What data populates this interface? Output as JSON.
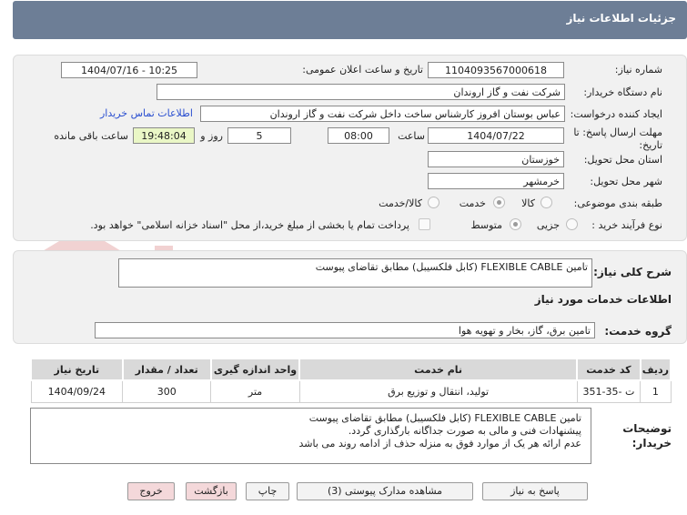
{
  "header": {
    "title": "جزئیات اطلاعات نیاز"
  },
  "fields": {
    "need_number_label": "شماره نیاز:",
    "need_number": "1104093567000618",
    "announce_label": "تاریخ و ساعت اعلان عمومی:",
    "announce_value": "1404/07/16 - 10:25",
    "buyer_label": "نام دستگاه خریدار:",
    "buyer_value": "شرکت نفت و گاز اروندان",
    "creator_label": "ایجاد کننده درخواست:",
    "creator_value": "عباس بوستان افروز کارشناس ساخت داخل شرکت نفت و گاز اروندان",
    "contact_link": "اطلاعات تماس خریدار",
    "deadline_label_1": "مهلت ارسال پاسخ: تا",
    "deadline_label_2": "تاریخ:",
    "deadline_date": "1404/07/22",
    "time_label": "ساعت",
    "deadline_time": "08:00",
    "days_value": "5",
    "days_label": "روز و",
    "remaining_time": "19:48:04",
    "remaining_label": "ساعت باقی مانده",
    "province_label": "استان محل تحویل:",
    "province_value": "خوزستان",
    "city_label": "شهر محل تحویل:",
    "city_value": "خرمشهر",
    "category_label": "طبقه بندی موضوعی:",
    "category_options": [
      "کالا",
      "خدمت",
      "کالا/خدمت"
    ],
    "process_label": "نوع فرآیند خرید :",
    "process_options": [
      "جزیی",
      "متوسط"
    ],
    "payment_note": "پرداخت تمام یا بخشی از مبلغ خرید،از محل \"اسناد خزانه اسلامی\" خواهد بود."
  },
  "description": {
    "label": "شرح کلی نیاز:",
    "value": "تامین FLEXIBLE CABLE (کابل فلکسیبل) مطابق تقاضای پیوست"
  },
  "services": {
    "section_title": "اطلاعات خدمات مورد نیاز",
    "group_label": "گروه خدمت:",
    "group_value": "تامین برق، گاز، بخار و تهویه هوا"
  },
  "table": {
    "headers": [
      "ردیف",
      "کد خدمت",
      "نام خدمت",
      "واحد اندازه گیری",
      "تعداد / مقدار",
      "تاریخ نیاز"
    ],
    "rows": [
      [
        "1",
        "ت -35-351",
        "تولید، انتقال و توزیع برق",
        "متر",
        "300",
        "1404/09/24"
      ]
    ]
  },
  "notes": {
    "label_1": "توضیحات",
    "label_2": "خریدار:",
    "lines": [
      "تامین FLEXIBLE CABLE (کابل فلکسیبل) مطابق تقاضای پیوست",
      "پیشنهادات فنی و مالی به صورت جداگانه بارگذاری گردد.",
      "عدم ارائه هر یک از موارد فوق به منزله حذف از ادامه روند می باشد"
    ]
  },
  "buttons": {
    "reply": "پاسخ به نیاز",
    "attachments": "مشاهده مدارک پیوستی (3)",
    "print": "چاپ",
    "back": "بازگشت",
    "exit": "خروج"
  },
  "colors": {
    "header_bg": "#6d7e96",
    "panel_bg": "#f1f1f1",
    "highlight_green": "#eaf7c6",
    "link": "#2a4fd0",
    "watermark_red": "#e7b5b5"
  }
}
